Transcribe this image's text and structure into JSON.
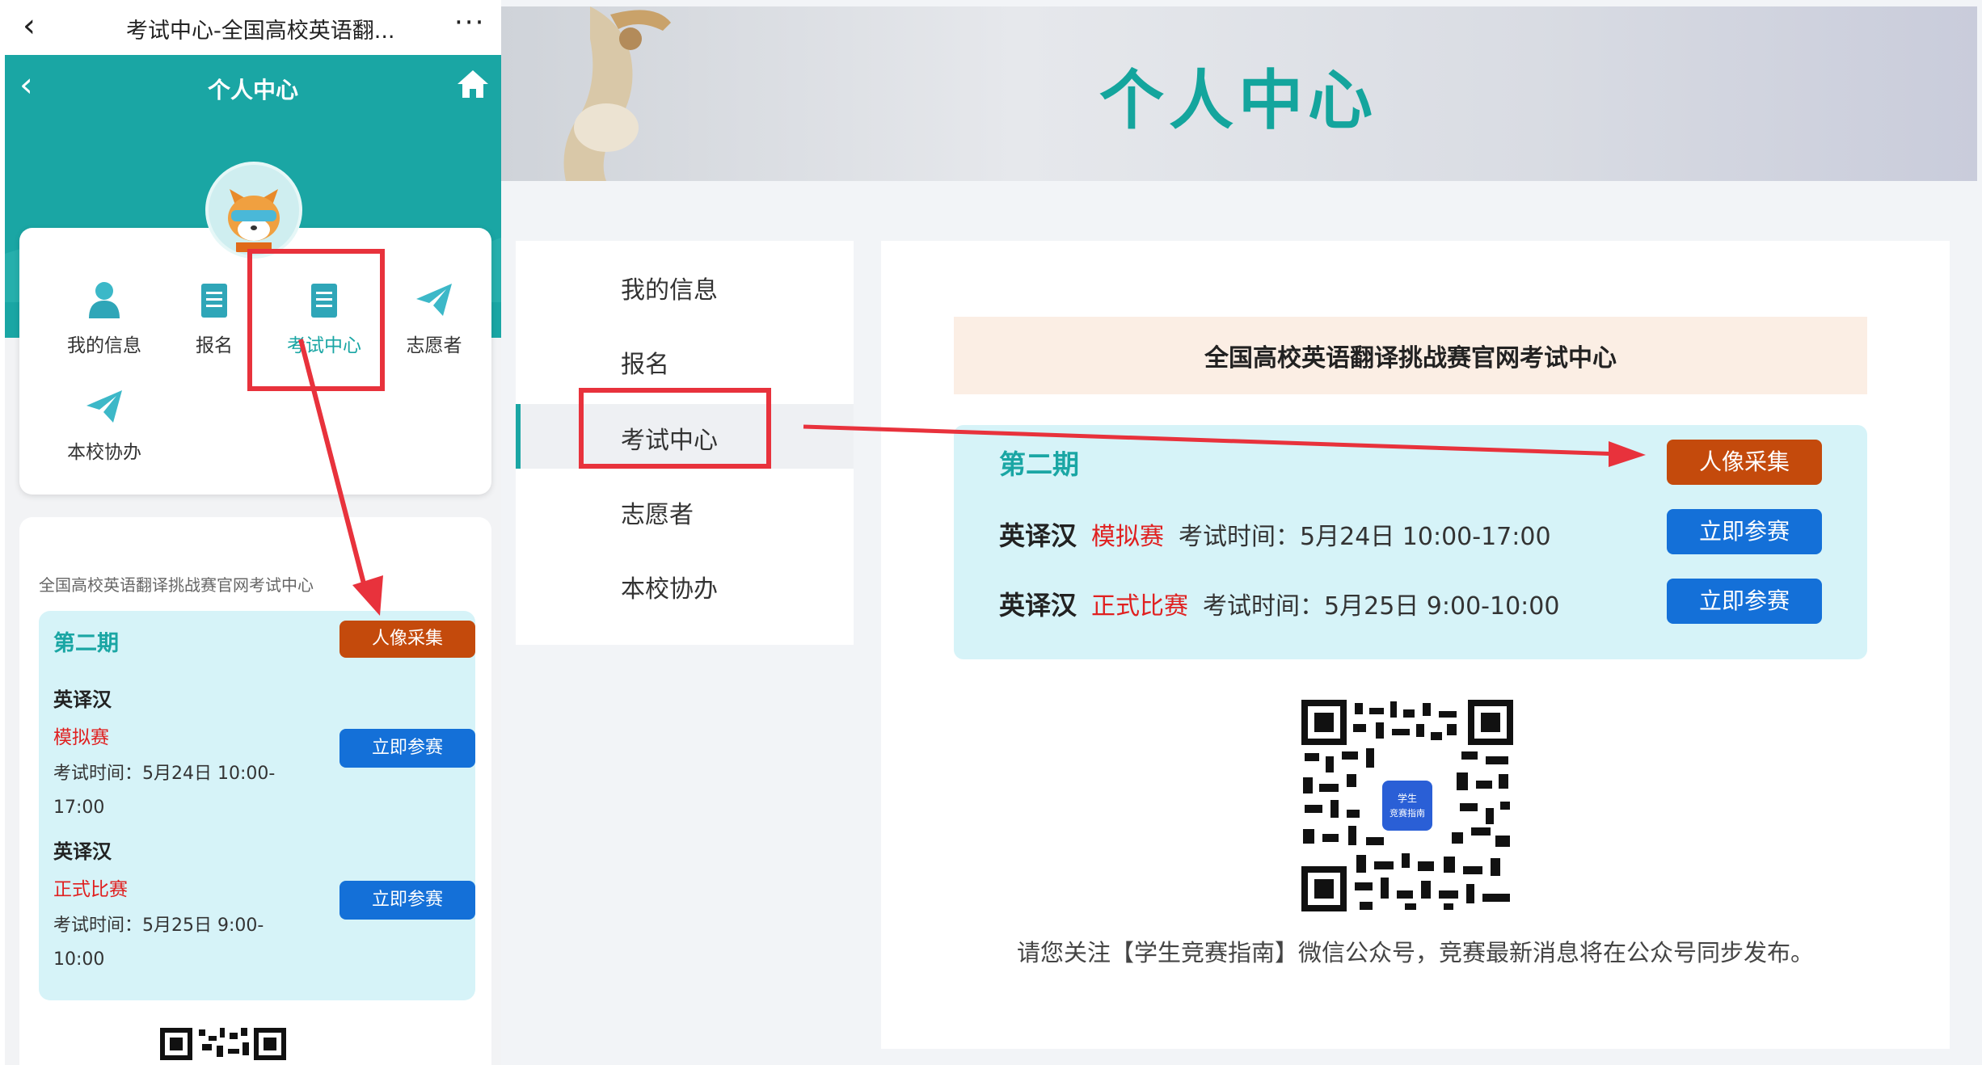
{
  "mobile": {
    "topbar": {
      "title": "考试中心-全国高校英语翻...",
      "more": "···"
    },
    "header": {
      "title": "个人中心"
    },
    "menu": [
      {
        "label": "我的信息",
        "icon": "user-icon"
      },
      {
        "label": "报名",
        "icon": "document-icon"
      },
      {
        "label": "考试中心",
        "icon": "document-icon"
      },
      {
        "label": "志愿者",
        "icon": "paper-plane-icon"
      },
      {
        "label": "本校协办",
        "icon": "paper-plane-icon"
      }
    ],
    "card": {
      "heading": "全国高校英语翻译挑战赛官网考试中心",
      "period": "第二期",
      "photo_button": "人像采集",
      "exams": [
        {
          "name": "英译汉",
          "type": "模拟赛",
          "time": "考试时间：5月24日 10:00-17:00",
          "button": "立即参赛"
        },
        {
          "name": "英译汉",
          "type": "正式比赛",
          "time": "考试时间：5月25日 9:00-10:00",
          "button": "立即参赛"
        }
      ]
    }
  },
  "desktop": {
    "banner_title": "个人中心",
    "sidebar": [
      "我的信息",
      "报名",
      "考试中心",
      "志愿者",
      "本校协办"
    ],
    "active_item": "考试中心",
    "title": "全国高校英语翻译挑战赛官网考试中心",
    "period": "第二期",
    "photo_button": "人像采集",
    "exams": [
      {
        "name": "英译汉",
        "type": "模拟赛",
        "time": "考试时间：5月24日 10:00-17:00",
        "button": "立即参赛"
      },
      {
        "name": "英译汉",
        "type": "正式比赛",
        "time": "考试时间：5月25日 9:00-10:00",
        "button": "立即参赛"
      }
    ],
    "qr_badge": [
      "学生",
      "竞赛指南"
    ],
    "note": "请您关注【学生竞赛指南】微信公众号，竞赛最新消息将在公众号同步发布。"
  },
  "colors": {
    "teal": "#1aa6a4",
    "orange_button": "#c44a0c",
    "blue_button": "#1470d8",
    "panel_bg": "#d6f3f8",
    "title_bg": "#fbeee4",
    "red_text": "#e02020",
    "annotation_red": "#e8323c"
  }
}
